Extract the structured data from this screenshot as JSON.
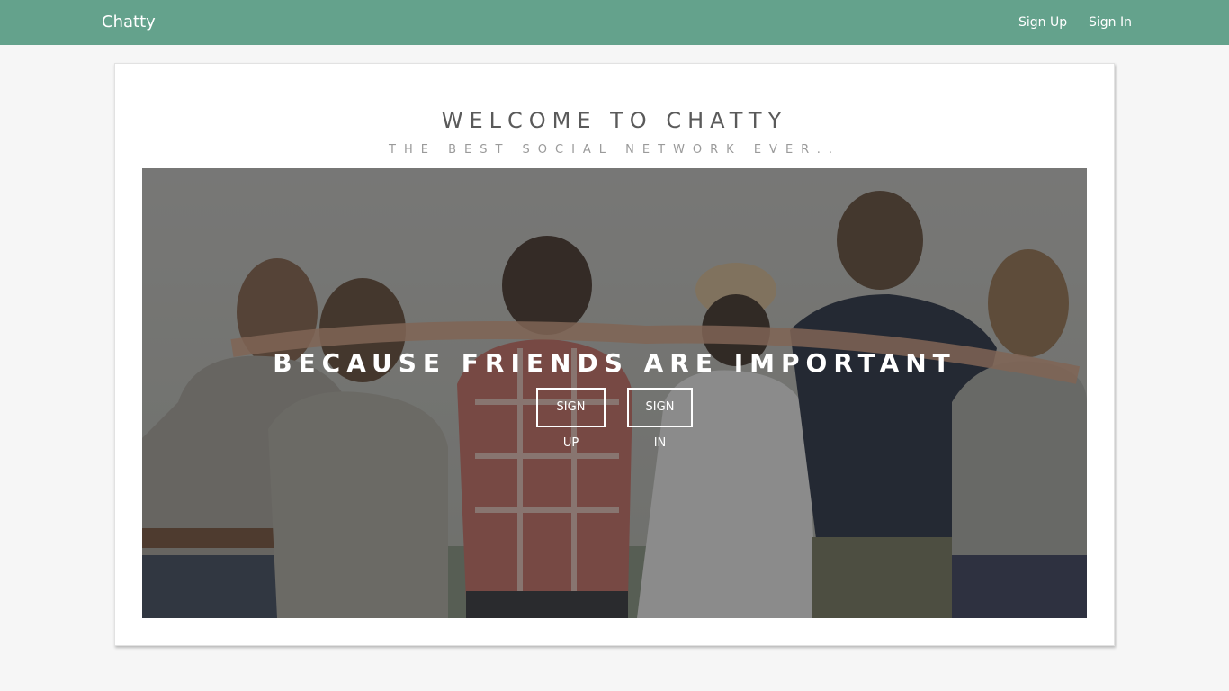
{
  "navbar": {
    "brand": "Chatty",
    "links": [
      {
        "label": "Sign Up"
      },
      {
        "label": "Sign In"
      }
    ],
    "background": "#64a28c"
  },
  "main": {
    "title": "WELCOME TO CHATTY",
    "subtitle": "THE BEST SOCIAL NETWORK EVER..",
    "hero": {
      "tagline": "BECAUSE FRIENDS ARE IMPORTANT",
      "signup_label": "SIGN UP",
      "signin_label": "SIGN IN"
    }
  }
}
